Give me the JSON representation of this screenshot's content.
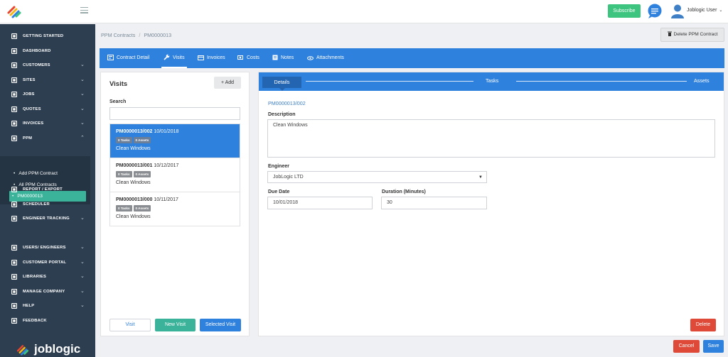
{
  "header": {
    "subscribe_label": "Subscribe",
    "user_name": "Joblogic User",
    "user_caret": "⌄"
  },
  "sidebar": {
    "items": [
      {
        "label": "GETTING STARTED",
        "icon": "rocket-icon",
        "chevron": ""
      },
      {
        "label": "DASHBOARD",
        "icon": "dashboard-icon",
        "chevron": ""
      },
      {
        "label": "CUSTOMERS",
        "icon": "user-icon",
        "chevron": "⌄"
      },
      {
        "label": "SITES",
        "icon": "building-icon",
        "chevron": "⌄"
      },
      {
        "label": "JOBS",
        "icon": "wrench-icon",
        "chevron": "⌄"
      },
      {
        "label": "QUOTES",
        "icon": "document-icon",
        "chevron": "⌄"
      },
      {
        "label": "INVOICES",
        "icon": "invoice-icon",
        "chevron": "⌄"
      },
      {
        "label": "PPM",
        "icon": "calendar-icon",
        "chevron": "⌃"
      },
      {
        "label": "REPORT / EXPORT",
        "icon": "export-icon",
        "chevron": ""
      },
      {
        "label": "SCHEDULER",
        "icon": "scheduler-icon",
        "chevron": ""
      },
      {
        "label": "ENGINEER TRACKING",
        "icon": "location-icon",
        "chevron": "⌄"
      },
      {
        "label": "USERS/ ENGINEERS",
        "icon": "user-icon",
        "chevron": "⌄"
      },
      {
        "label": "CUSTOMER PORTAL",
        "icon": "headset-icon",
        "chevron": "⌄"
      },
      {
        "label": "LIBRARIES",
        "icon": "library-icon",
        "chevron": "⌄"
      },
      {
        "label": "MANAGE COMPANY",
        "icon": "manage-icon",
        "chevron": "⌄"
      },
      {
        "label": "HELP",
        "icon": "help-icon",
        "chevron": "⌄"
      },
      {
        "label": "FEEDBACK",
        "icon": "feedback-icon",
        "chevron": ""
      }
    ],
    "ppm_sub": [
      {
        "label": "Add PPM Contract"
      },
      {
        "label": "All PPM Contracts"
      },
      {
        "label": "PM0000013"
      }
    ],
    "brand": "joblogic"
  },
  "breadcrumb": {
    "parent": "PPM Contracts",
    "separator": "/",
    "current": "PM0000013"
  },
  "delete_contract_label": "Delete PPM Contract",
  "tabs": [
    {
      "label": "Contract Detail",
      "icon": "contract-icon"
    },
    {
      "label": "Visits",
      "icon": "wrench-icon"
    },
    {
      "label": "Invoices",
      "icon": "invoice-icon"
    },
    {
      "label": "Costs",
      "icon": "costs-icon"
    },
    {
      "label": "Notes",
      "icon": "notes-icon"
    },
    {
      "label": "Attachments",
      "icon": "attachment-icon"
    }
  ],
  "visits": {
    "title": "Visits",
    "add_label": "+  Add",
    "search_label": "Search",
    "search_value": "",
    "items": [
      {
        "id": "PM0000013/002",
        "date": "10/01/2018",
        "tasks": "0 Tasks",
        "assets": "0 Assets",
        "description": "Clean Windows"
      },
      {
        "id": "PM0000013/001",
        "date": "10/12/2017",
        "tasks": "0 Tasks",
        "assets": "0 Assets",
        "description": "Clean Windows"
      },
      {
        "id": "PM0000013/000",
        "date": "10/11/2017",
        "tasks": "0 Tasks",
        "assets": "0 Assets",
        "description": "Clean Windows"
      }
    ],
    "buttons": {
      "visit": "Visit",
      "new_visit": "New Visit",
      "selected_visit": "Selected Visit"
    }
  },
  "detail": {
    "steps": [
      "Details",
      "Tasks",
      "Assets"
    ],
    "reference": "PM0000013/002",
    "description_label": "Description",
    "description_value": "Clean Windows",
    "engineer_label": "Engineer",
    "engineer_value": "JobLogic LTD",
    "due_date_label": "Due Date",
    "due_date_value": "10/01/2018",
    "duration_label": "Duration (Minutes)",
    "duration_value": "30",
    "delete_label": "Delete"
  },
  "footer": {
    "cancel_label": "Cancel",
    "save_label": "Save"
  },
  "colors": {
    "sidebar": "#2d3e50",
    "primary": "#2f81de",
    "success": "#3dc47e",
    "danger": "#df4a38",
    "teal": "#3ab39a"
  }
}
